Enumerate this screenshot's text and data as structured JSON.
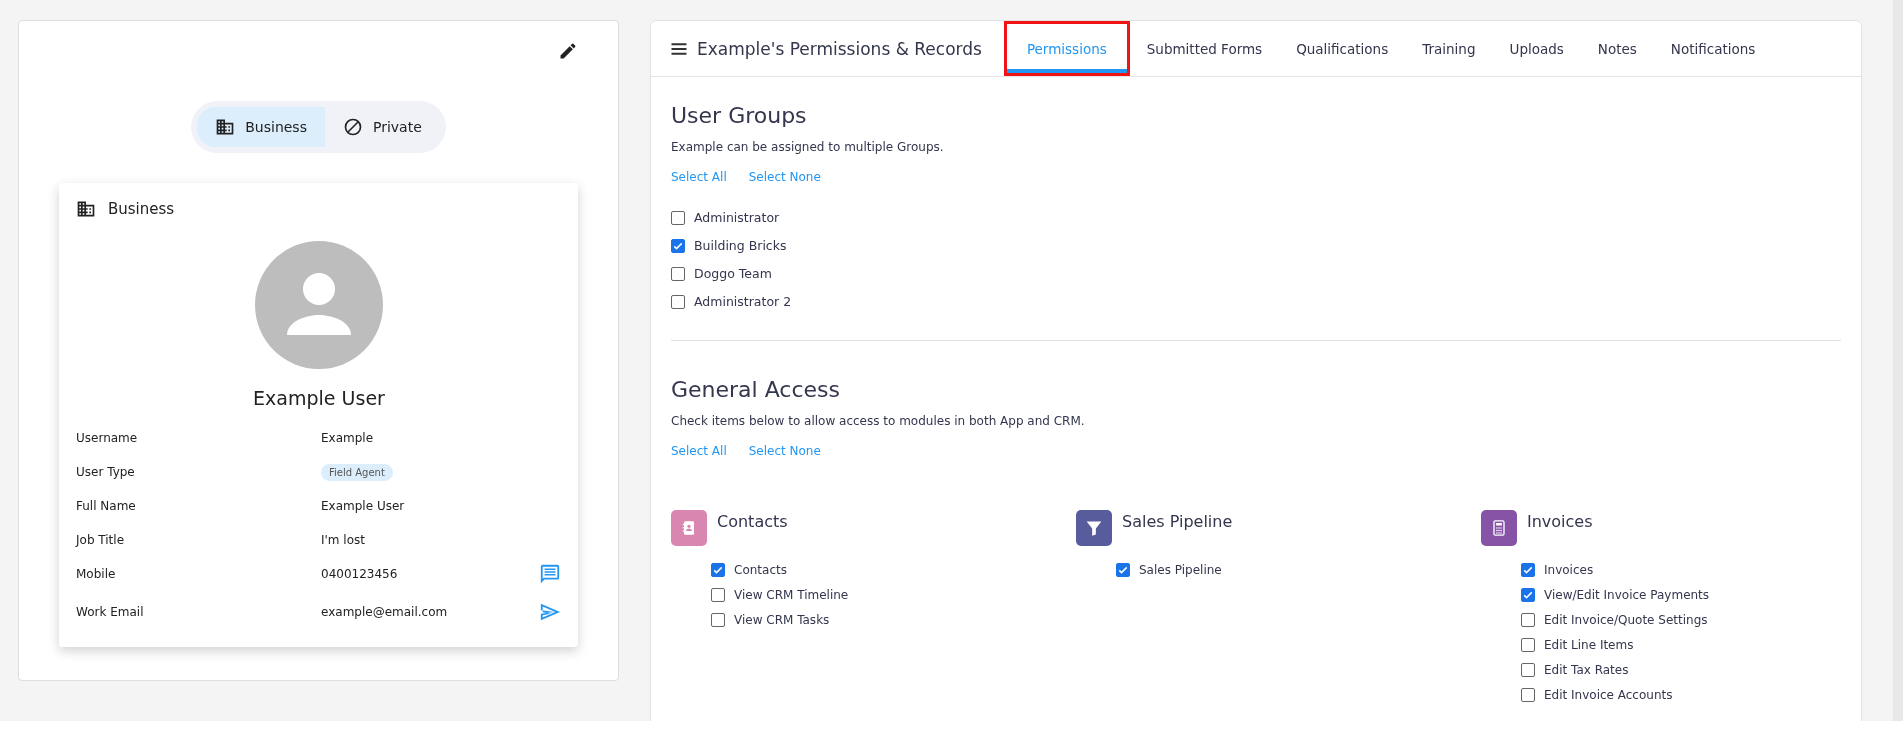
{
  "profile": {
    "mode_toggle": [
      {
        "label": "Business",
        "selected": true,
        "kind": "building"
      },
      {
        "label": "Private",
        "selected": false,
        "kind": "block"
      }
    ],
    "card": {
      "title": "Business",
      "name": "Example User",
      "fields": [
        {
          "label": "Username",
          "value": "Example",
          "kind": "text"
        },
        {
          "label": "User Type",
          "value": "Field Agent",
          "kind": "chip"
        },
        {
          "label": "Full Name",
          "value": "Example User",
          "kind": "text"
        },
        {
          "label": "Job Title",
          "value": "I'm lost",
          "kind": "text"
        },
        {
          "label": "Mobile",
          "value": "0400123456",
          "kind": "phone"
        },
        {
          "label": "Work Email",
          "value": "example@email.com",
          "kind": "email"
        }
      ]
    }
  },
  "records": {
    "title": "Example's Permissions & Records",
    "tabs": [
      {
        "label": "Permissions",
        "selected": true,
        "highlighted": true
      },
      {
        "label": "Submitted Forms",
        "selected": false,
        "highlighted": false
      },
      {
        "label": "Qualifications",
        "selected": false,
        "highlighted": false
      },
      {
        "label": "Training",
        "selected": false,
        "highlighted": false
      },
      {
        "label": "Uploads",
        "selected": false,
        "highlighted": false
      },
      {
        "label": "Notes",
        "selected": false,
        "highlighted": false
      },
      {
        "label": "Notifications",
        "selected": false,
        "highlighted": false
      }
    ],
    "user_groups": {
      "title": "User Groups",
      "subtitle": "Example can be assigned to multiple Groups.",
      "links": [
        "Select All",
        "Select None"
      ],
      "items": [
        {
          "label": "Administrator",
          "checked": false
        },
        {
          "label": "Building Bricks",
          "checked": true
        },
        {
          "label": "Doggo Team",
          "checked": false
        },
        {
          "label": "Administrator 2",
          "checked": false
        }
      ]
    },
    "general_access": {
      "title": "General Access",
      "subtitle": "Check items below to allow access to modules in both App and CRM.",
      "links": [
        "Select All",
        "Select None"
      ],
      "modules": [
        {
          "title": "Contacts",
          "kind": "contacts",
          "color": "#d987b0",
          "items": [
            {
              "label": "Contacts",
              "checked": true
            },
            {
              "label": "View CRM Timeline",
              "checked": false
            },
            {
              "label": "View CRM Tasks",
              "checked": false
            }
          ]
        },
        {
          "title": "Sales Pipeline",
          "kind": "filter",
          "color": "#585c9c",
          "items": [
            {
              "label": "Sales Pipeline",
              "checked": true
            }
          ]
        },
        {
          "title": "Invoices",
          "kind": "calculator",
          "color": "#8653a6",
          "items": [
            {
              "label": "Invoices",
              "checked": true
            },
            {
              "label": "View/Edit Invoice Payments",
              "checked": true
            },
            {
              "label": "Edit Invoice/Quote Settings",
              "checked": false
            },
            {
              "label": "Edit Line Items",
              "checked": false
            },
            {
              "label": "Edit Tax Rates",
              "checked": false
            },
            {
              "label": "Edit Invoice Accounts",
              "checked": false
            }
          ]
        }
      ]
    }
  }
}
